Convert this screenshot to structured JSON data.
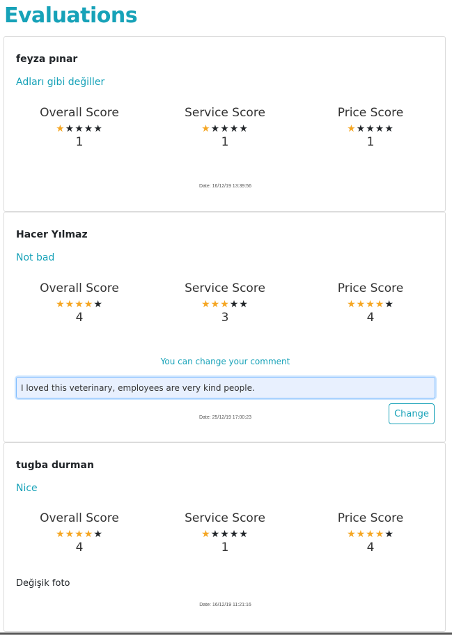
{
  "page": {
    "title": "Evaluations"
  },
  "labels": {
    "overall": "Overall Score",
    "service": "Service Score",
    "price": "Price Score"
  },
  "colors": {
    "accent": "#17a2b8",
    "star_filled": "#f5a623",
    "star_empty": "#212529"
  },
  "evaluations": [
    {
      "author": "feyza pınar",
      "comment": "Adları gibi değiller",
      "overall": 1,
      "service": 1,
      "price": 1,
      "date": "Date: 16/12/19 13:39:56"
    },
    {
      "author": "Hacer Yılmaz",
      "comment": "Not bad",
      "overall": 4,
      "service": 3,
      "price": 4,
      "change_hint": "You can change your comment",
      "input_value": "I loved this veterinary, employees are very kind people.",
      "change_button": "Change",
      "date": "Date: 25/12/19 17:00:23"
    },
    {
      "author": "tugba durman",
      "comment": "Nice",
      "overall": 4,
      "service": 1,
      "price": 4,
      "note": "Değişik foto",
      "date": "Date: 16/12/19 11:21:16"
    }
  ],
  "max_stars": 5
}
